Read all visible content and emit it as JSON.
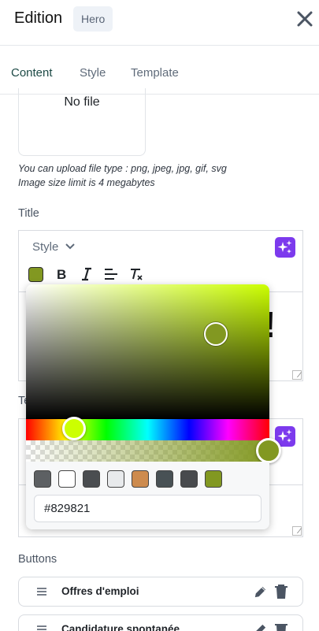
{
  "header": {
    "title": "Edition",
    "badge": "Hero"
  },
  "tabs": [
    {
      "label": "Content",
      "active": true
    },
    {
      "label": "Style",
      "active": false
    },
    {
      "label": "Template",
      "active": false
    }
  ],
  "upload": {
    "no_file": "No file",
    "hint_types": "You can upload file type : png, jpeg, jpg, gif, svg",
    "hint_size": "Image size limit is 4 megabytes"
  },
  "title_section": {
    "label": "Title",
    "style_selector": "Style",
    "editor_char": "!"
  },
  "text_section": {
    "label_fragment": "Te"
  },
  "color_picker": {
    "hex_value": "#829821",
    "selected_color": "#829821",
    "hue_color": "#ccff00",
    "swatches": [
      "#5d6063",
      "#ffffff",
      "#4a4d50",
      "#e8eaec",
      "#cd8b4e",
      "#485155",
      "#484a4d",
      "#829821"
    ]
  },
  "buttons_section": {
    "label": "Buttons",
    "items": [
      {
        "label": "Offres d'emploi"
      },
      {
        "label": "Candidature spontanée"
      }
    ]
  },
  "icons": {
    "close": "close-icon",
    "ai": "sparkles-icon",
    "bold": "bold-icon",
    "italic": "italic-icon",
    "align": "align-left-icon",
    "clear": "clear-format-icon",
    "drag": "drag-handle-icon",
    "edit": "pencil-icon",
    "delete": "trash-icon"
  }
}
